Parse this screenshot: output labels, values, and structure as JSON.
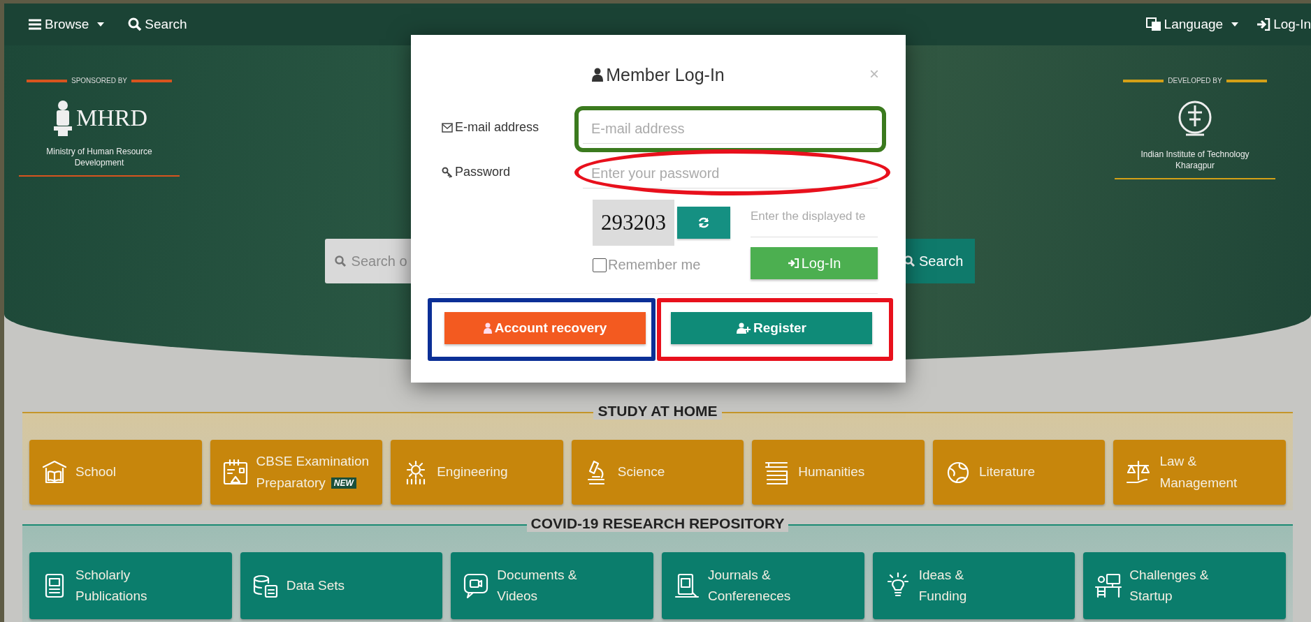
{
  "top_bar": {
    "browse": "Browse",
    "search": "Search",
    "language": "Language",
    "login": "Log-In"
  },
  "hero": {
    "sponsor": {
      "caption": "SPONSORED BY",
      "logo_text": "MHRD",
      "name": "Ministry of Human Resource Development"
    },
    "developer": {
      "caption": "DEVELOPED BY",
      "name": "Indian Institute of Technology Kharagpur"
    },
    "search": {
      "placeholder": "Search o",
      "button": "Search"
    }
  },
  "modal": {
    "title": "Member Log-In",
    "close": "×",
    "email": {
      "label": "E-mail address",
      "placeholder": "E-mail address",
      "highlight": {
        "kind": "rounded",
        "color": "#3b7a1e"
      }
    },
    "password": {
      "label": "Password",
      "placeholder": "Enter your password",
      "highlight": {
        "kind": "ellipse",
        "color": "#e8101c"
      }
    },
    "captcha": {
      "code": "293203",
      "placeholder": "Enter the displayed te"
    },
    "remember": {
      "label": "Remember me",
      "checked": false
    },
    "login_button": "Log-In",
    "recovery_button": {
      "label": "Account recovery",
      "highlight": {
        "kind": "rect",
        "color": "#0b2f96"
      }
    },
    "register_button": {
      "label": "Register",
      "highlight": {
        "kind": "rect",
        "color": "#e8101c"
      }
    }
  },
  "sections": [
    {
      "title": "STUDY AT HOME",
      "kind": "study",
      "tiles": [
        {
          "lines": [
            "School"
          ]
        },
        {
          "lines": [
            "CBSE Examination",
            "Preparatory"
          ],
          "badge": "NEW"
        },
        {
          "lines": [
            "Engineering"
          ]
        },
        {
          "lines": [
            "Science"
          ]
        },
        {
          "lines": [
            "Humanities"
          ]
        },
        {
          "lines": [
            "Literature"
          ]
        },
        {
          "lines": [
            "Law &",
            "Management"
          ]
        }
      ]
    },
    {
      "title": "COVID-19 RESEARCH REPOSITORY",
      "kind": "covid",
      "tiles": [
        {
          "lines": [
            "Scholarly",
            "Publications"
          ]
        },
        {
          "lines": [
            "Data Sets"
          ]
        },
        {
          "lines": [
            "Documents &",
            "Videos"
          ]
        },
        {
          "lines": [
            "Journals &",
            "Confereneces"
          ]
        },
        {
          "lines": [
            "Ideas &",
            "Funding"
          ]
        },
        {
          "lines": [
            "Challenges &",
            "Startup"
          ]
        }
      ]
    }
  ]
}
